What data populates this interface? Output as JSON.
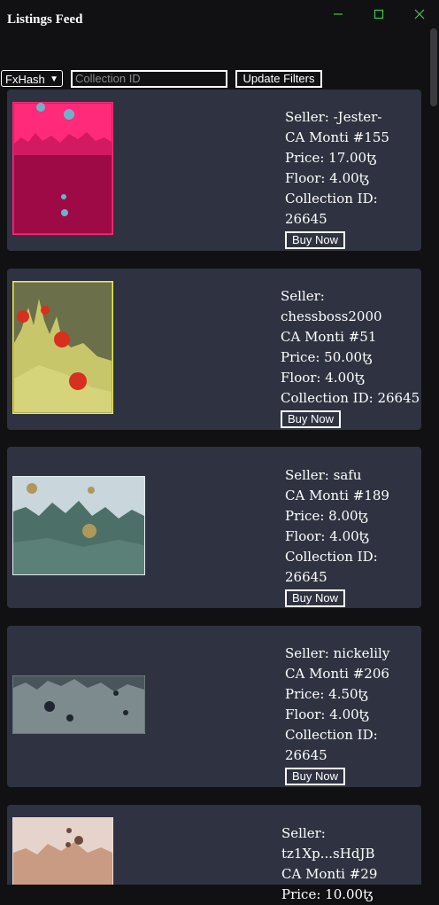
{
  "app": {
    "title": "Listings Feed"
  },
  "filters": {
    "marketplace": "FxHash",
    "collection_placeholder": "Collection ID",
    "update_label": "Update Filters"
  },
  "listings": [
    {
      "seller": "Seller: -Jester-",
      "title": "CA Monti #155",
      "price": "Price: 17.00ꜩ",
      "floor": "Floor: 4.00ꜩ",
      "collection": "Collection ID: 26645",
      "buy": "Buy Now"
    },
    {
      "seller": "Seller: chessboss2000",
      "title": "CA Monti #51",
      "price": "Price: 50.00ꜩ",
      "floor": "Floor: 4.00ꜩ",
      "collection": "Collection ID: 26645",
      "buy": "Buy Now"
    },
    {
      "seller": "Seller: safu",
      "title": "CA Monti #189",
      "price": "Price: 8.00ꜩ",
      "floor": "Floor: 4.00ꜩ",
      "collection": "Collection ID: 26645",
      "buy": "Buy Now"
    },
    {
      "seller": "Seller: nickelily",
      "title": "CA Monti #206",
      "price": "Price: 4.50ꜩ",
      "floor": "Floor: 4.00ꜩ",
      "collection": "Collection ID: 26645",
      "buy": "Buy Now"
    },
    {
      "seller": "Seller: tz1Xp...sHdJB",
      "title": "CA Monti #29",
      "price": "Price: 10.00ꜩ",
      "floor": "",
      "collection": "",
      "buy": ""
    }
  ]
}
